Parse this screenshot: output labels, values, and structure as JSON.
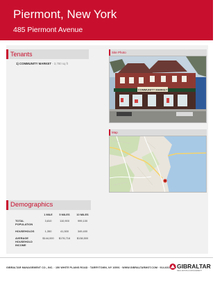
{
  "header": {
    "title": "Piermont, New York",
    "address": "485 Piermont Avenue"
  },
  "tenants": {
    "heading": "Tenants",
    "items": [
      {
        "number": "1)",
        "name": "COMMUNITY MARKET",
        "size": "- 3,780 sq ft"
      }
    ]
  },
  "photo": {
    "heading": "Site Photo",
    "sign_text": "COMMUNITY MARKET"
  },
  "map": {
    "heading": "Map"
  },
  "demographics": {
    "heading": "Demographics",
    "columns": [
      "1 MILE",
      "5 MILES",
      "10 MILES"
    ],
    "rows": [
      {
        "label": "TOTAL POPULATION",
        "values": [
          "3,810",
          "110,900",
          "999,100"
        ]
      },
      {
        "label": "HOUSEHOLDS",
        "values": [
          "1,350",
          "41,500",
          "349,400"
        ]
      },
      {
        "label": "AVERAGE HOUSEHOLD INCOME",
        "values": [
          "$144,000",
          "$176,716",
          "$138,500"
        ]
      }
    ]
  },
  "footer": {
    "text": "GIBRALTAR MANAGEMENT CO., INC. · 150 WHITE PLAINS ROAD · TARRYTOWN, NY 10591 · WWW.GIBRALTARMGT.COM · 914-631-4200",
    "logo_text": "GIBRALTAR",
    "logo_sub": "REAL ESTATE & MANAGEMENT"
  },
  "colors": {
    "brand_red": "#c8102e",
    "panel_gray": "#f1f1f1",
    "heading_gray": "#dcdcdc"
  }
}
